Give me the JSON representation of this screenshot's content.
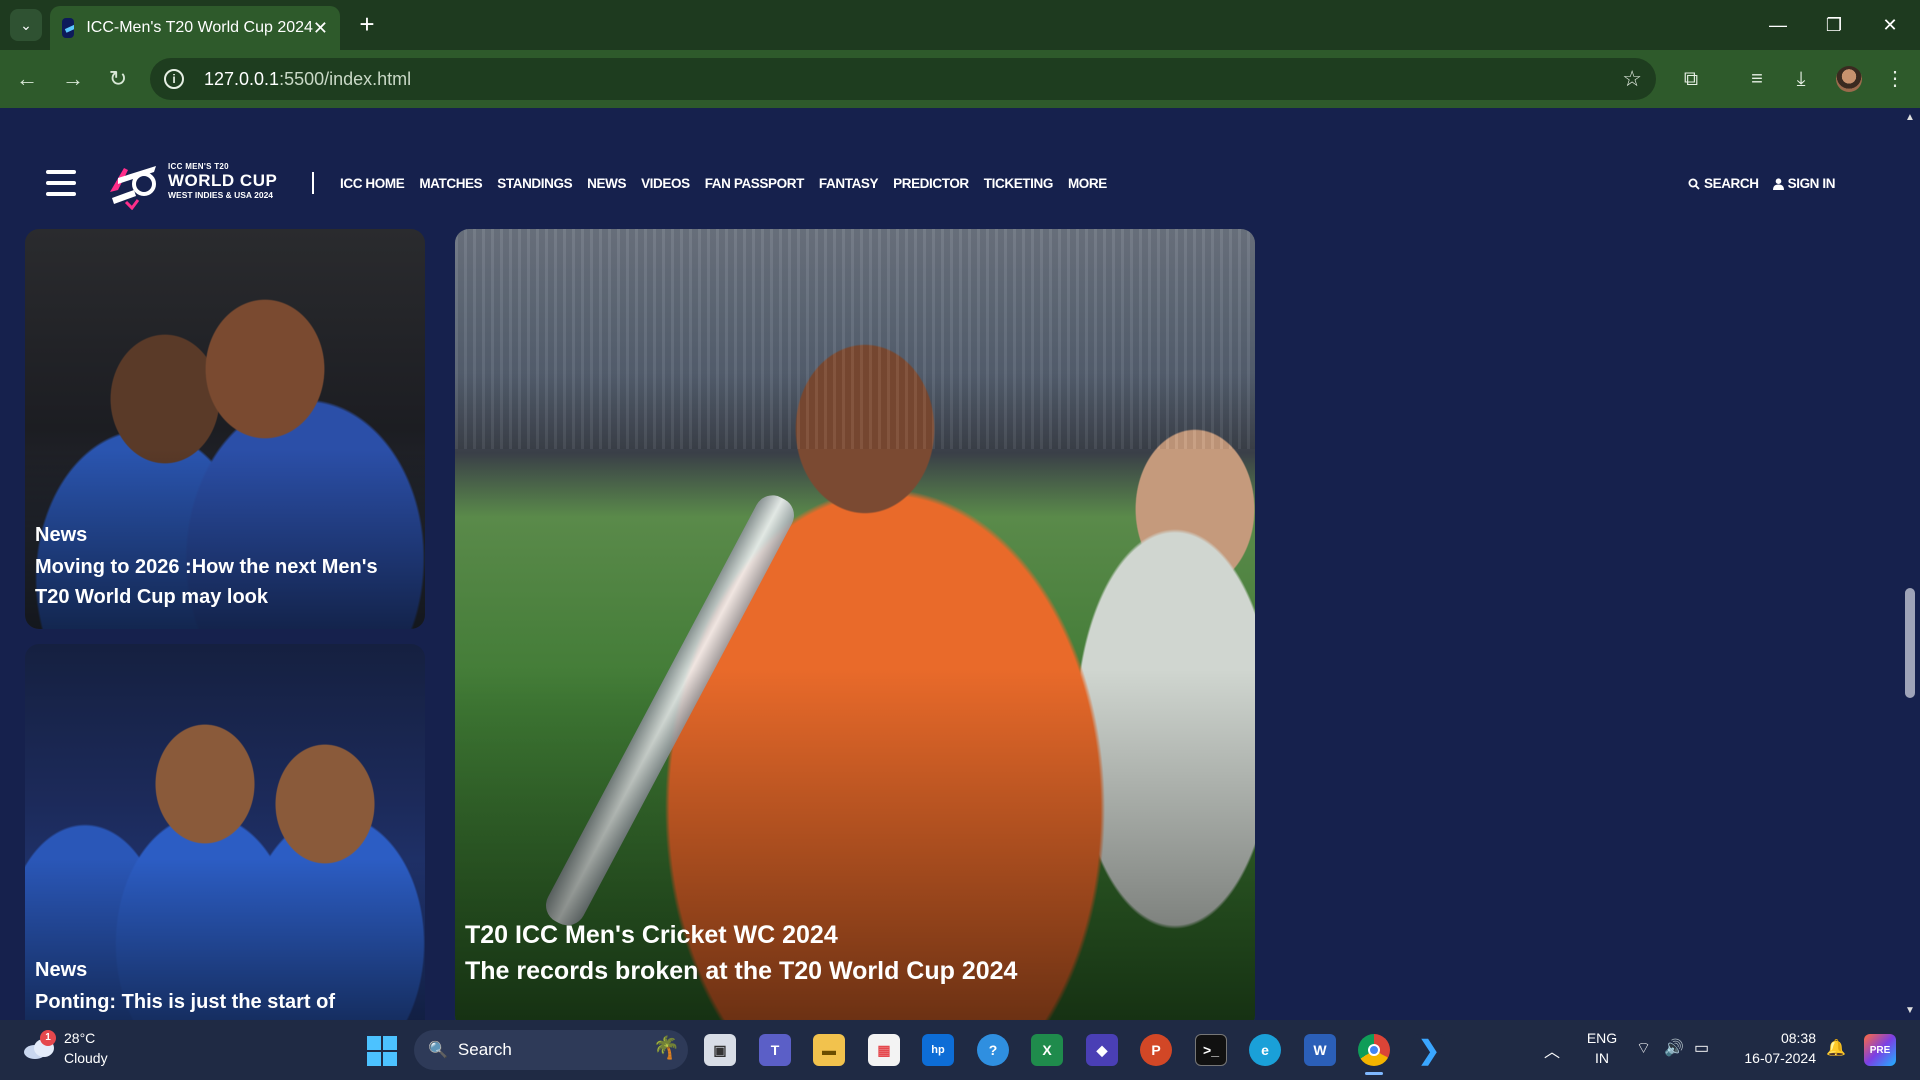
{
  "browser": {
    "tab_title": "ICC-Men's T20 World Cup 2024",
    "url_host": "127.0.0.1",
    "url_path": ":5500/index.html"
  },
  "site": {
    "logo_small": "ICC MEN'S T20",
    "logo_big": "WORLD CUP",
    "logo_sub": "WEST INDIES & USA 2024",
    "nav": [
      "ICC HOME",
      "MATCHES",
      "STANDINGS",
      "NEWS",
      "VIDEOS",
      "FAN PASSPORT",
      "FANTASY",
      "PREDICTOR",
      "TICKETING",
      "MORE"
    ],
    "search_label": "SEARCH",
    "signin_label": "SIGN IN"
  },
  "cards": [
    {
      "category": "News",
      "title": "Moving to 2026 :How the next Men's T20 World Cup may look"
    },
    {
      "category": "News",
      "title": "Ponting: This is just the start of"
    },
    {
      "line1": "T20 ICC Men's Cricket WC 2024",
      "line2": "The records broken at the T20 World Cup 2024"
    }
  ],
  "taskbar": {
    "weather_temp": "28°C",
    "weather_cond": "Cloudy",
    "weather_badge": "1",
    "search_placeholder": "Search",
    "lang_top": "ENG",
    "lang_bottom": "IN",
    "time": "08:38",
    "date": "16-07-2024"
  },
  "colors": {
    "page_bg": "#16214d",
    "browser_frame": "#2e5a2b",
    "taskbar": "#1f2a44"
  }
}
